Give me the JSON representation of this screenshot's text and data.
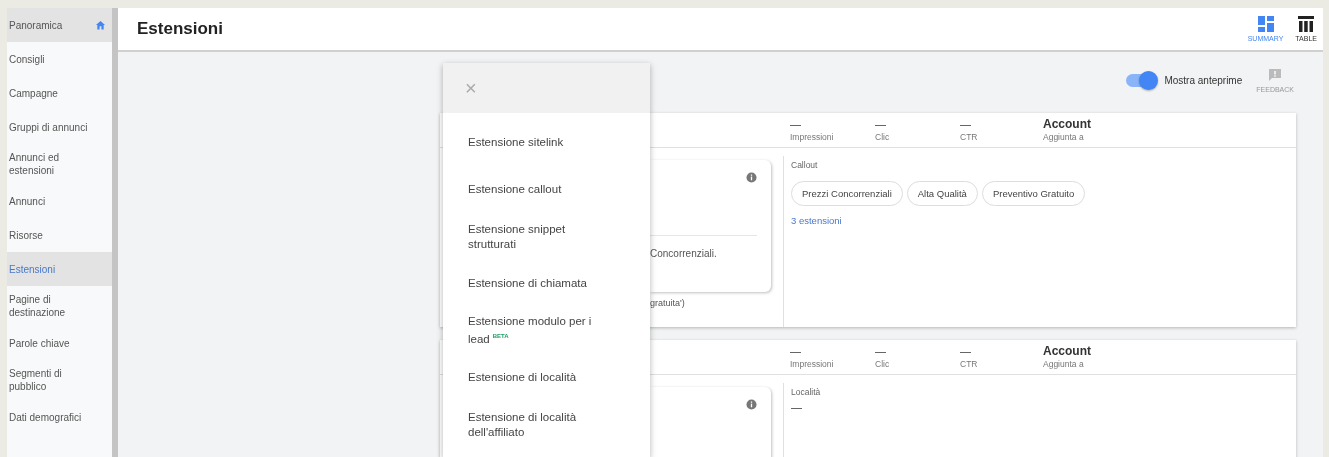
{
  "sidebar": {
    "items": [
      {
        "label": "Panoramica",
        "kind": "home",
        "selected": false
      },
      {
        "label": "Consigli",
        "kind": "plain",
        "selected": false
      },
      {
        "label": "Campagne",
        "kind": "plain",
        "selected": false
      },
      {
        "label": "Gruppi di annunci",
        "kind": "plain",
        "selected": false
      },
      {
        "label": "Annunci ed estensioni",
        "kind": "plain",
        "selected": false
      },
      {
        "label": "Annunci",
        "kind": "plain",
        "selected": false
      },
      {
        "label": "Risorse",
        "kind": "plain",
        "selected": false
      },
      {
        "label": "Estensioni",
        "kind": "plain",
        "selected": true
      },
      {
        "label": "Pagine di destinazione",
        "kind": "plain",
        "selected": false
      },
      {
        "label": "Parole chiave",
        "kind": "plain",
        "selected": false
      },
      {
        "label": "Segmenti di pubblico",
        "kind": "plain",
        "selected": false
      },
      {
        "label": "Dati demografici",
        "kind": "plain",
        "selected": false
      }
    ]
  },
  "header": {
    "title": "Estensioni",
    "views": [
      {
        "label": "SUMMARY",
        "kind": "summary",
        "selected": true
      },
      {
        "label": "TABLE",
        "kind": "table",
        "selected": false
      }
    ]
  },
  "toolbar": {
    "toggle": {
      "label": "Mostra anteprime",
      "on": true
    },
    "feedback": "FEEDBACK"
  },
  "cards": [
    {
      "stats": [
        {
          "value": "—",
          "label": "Impressioni"
        },
        {
          "value": "—",
          "label": "Clic"
        },
        {
          "value": "—",
          "label": "CTR"
        }
      ],
      "scope": {
        "value": "Account",
        "label": "Aggiunta a"
      },
      "preview_texts": [
        "Concorrenziali."
      ],
      "preview_note": "gratuita')",
      "section": "Callout",
      "chips": [
        "Prezzi Concorrenziali",
        "Alta Qualità",
        "Preventivo Gratuito"
      ],
      "link": "3 estensioni"
    },
    {
      "stats": [
        {
          "value": "—",
          "label": "Impressioni"
        },
        {
          "value": "—",
          "label": "Clic"
        },
        {
          "value": "—",
          "label": "CTR"
        }
      ],
      "scope": {
        "value": "Account",
        "label": "Aggiunta a"
      },
      "section": "Località",
      "empty_value": "—"
    }
  ],
  "menu": {
    "close": "×",
    "items": [
      {
        "label": "Estensione sitelink"
      },
      {
        "label": "Estensione callout"
      },
      {
        "label": "Estensione snippet strutturati"
      },
      {
        "label": "Estensione di chiamata"
      },
      {
        "label": "Estensione modulo per i lead",
        "badge": "BETA"
      },
      {
        "label": "Estensione di località"
      },
      {
        "label": "Estensione di località dell'affiliato"
      }
    ]
  }
}
